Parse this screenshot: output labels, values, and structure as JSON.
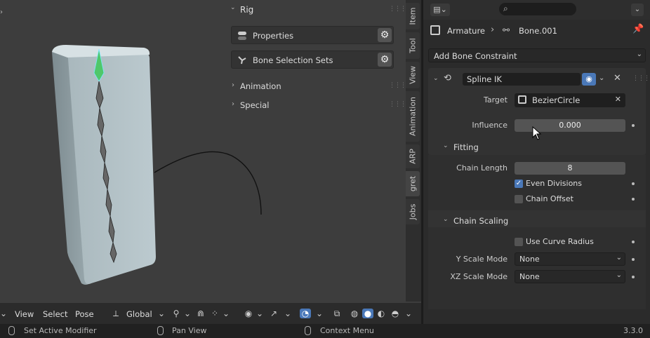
{
  "viewport": {
    "npanel": {
      "title": "Rig",
      "buttons": [
        {
          "label": "Properties",
          "icon": "toggles-icon"
        },
        {
          "label": "Bone Selection Sets",
          "icon": "bones-icon"
        }
      ],
      "subpanels": [
        "Animation",
        "Special"
      ]
    },
    "tabs": [
      "Item",
      "Tool",
      "View",
      "Animation",
      "ARP",
      "gret",
      "Jobs"
    ],
    "active_tab": "gret",
    "header": {
      "menus": [
        "View",
        "Select",
        "Pose"
      ],
      "orientation": "Global"
    }
  },
  "properties": {
    "breadcrumb": {
      "object": "Armature",
      "bone": "Bone.001"
    },
    "add_constraint_label": "Add Bone Constraint",
    "constraint": {
      "name": "Spline IK",
      "target_label": "Target",
      "target_value": "BezierCircle",
      "influence_label": "Influence",
      "influence_value": "0.000",
      "fitting": {
        "title": "Fitting",
        "chain_length_label": "Chain Length",
        "chain_length_value": "8",
        "even_divisions_label": "Even Divisions",
        "even_divisions_checked": true,
        "chain_offset_label": "Chain Offset",
        "chain_offset_checked": false
      },
      "chain_scaling": {
        "title": "Chain Scaling",
        "use_curve_radius_label": "Use Curve Radius",
        "use_curve_radius_checked": false,
        "y_scale_label": "Y Scale Mode",
        "y_scale_value": "None",
        "xz_scale_label": "XZ Scale Mode",
        "xz_scale_value": "None"
      }
    }
  },
  "statusbar": {
    "items": [
      "Set Active Modifier",
      "Pan View",
      "Context Menu"
    ],
    "version": "3.3.0"
  },
  "colors": {
    "accent": "#4a78b8",
    "bone_selected": "#4fc76a",
    "viewport_bg": "#3d3d3d",
    "panel_bg": "#2b2b2b"
  }
}
